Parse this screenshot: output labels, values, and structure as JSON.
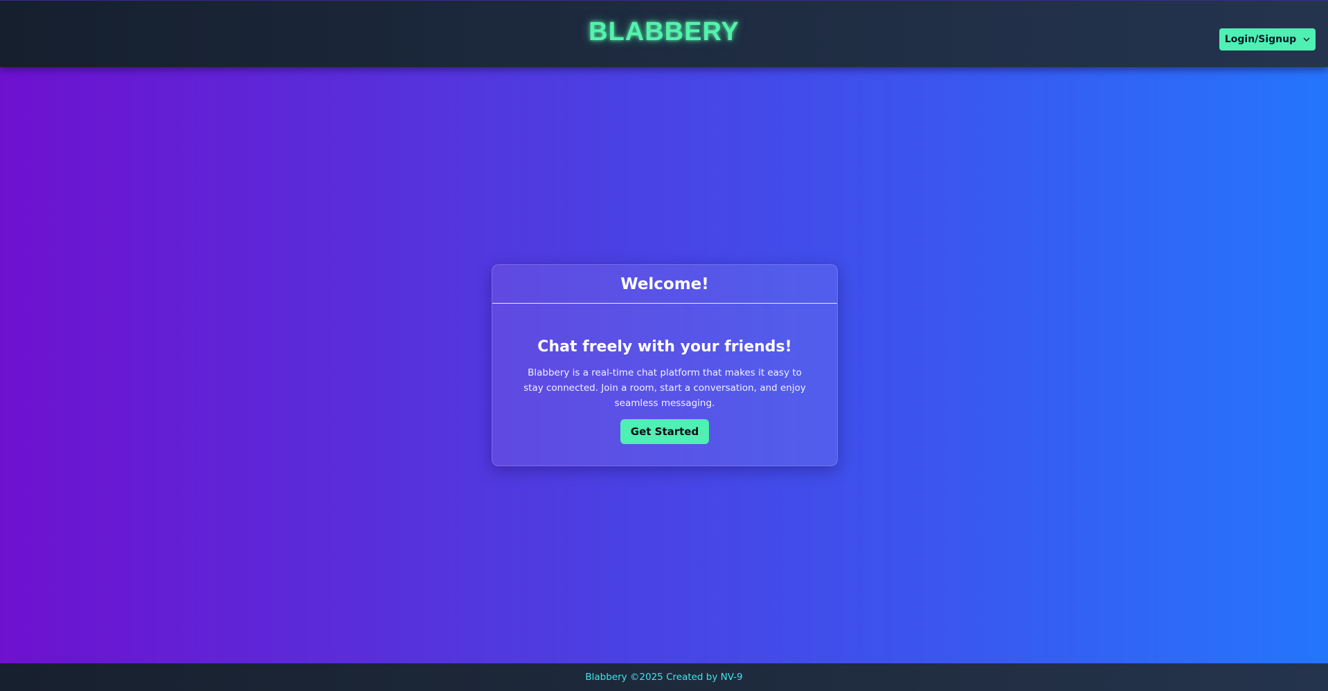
{
  "header": {
    "brand": "BLABBERY",
    "auth_label": "Login/Signup",
    "auth_icon": "chevron-down-icon"
  },
  "card": {
    "title": "Welcome!",
    "headline": "Chat freely with your friends!",
    "description": "Blabbery is a real-time chat platform that makes it easy to stay connected. Join a room, start a conversation, and enjoy seamless messaging.",
    "cta_label": "Get Started"
  },
  "footer": {
    "text": "Blabbery ©2025 Created by NV-9"
  },
  "colors": {
    "accent": "#4ef0b3",
    "brand_glow": "#54f2ab",
    "gradient_start": "#6e11cf",
    "gradient_end": "#2575fc",
    "footer_text": "#3ee6ec"
  }
}
